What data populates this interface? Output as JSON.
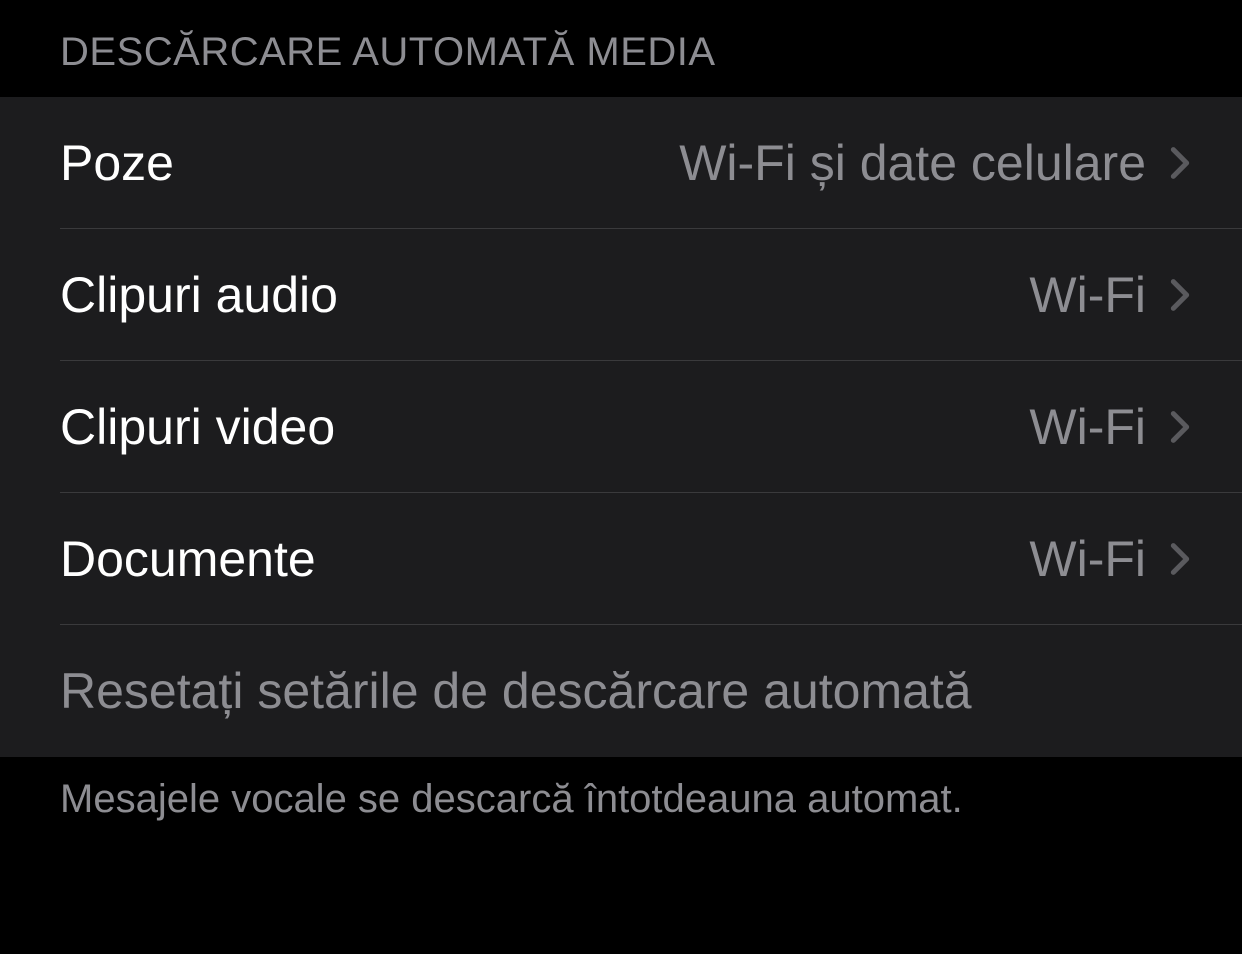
{
  "section": {
    "header": "DESCĂRCARE AUTOMATĂ MEDIA",
    "footer": "Mesajele vocale se descarcă întotdeauna automat."
  },
  "rows": [
    {
      "label": "Poze",
      "value": "Wi-Fi și date celulare"
    },
    {
      "label": "Clipuri audio",
      "value": "Wi-Fi"
    },
    {
      "label": "Clipuri video",
      "value": "Wi-Fi"
    },
    {
      "label": "Documente",
      "value": "Wi-Fi"
    }
  ],
  "reset": {
    "label": "Resetați setările de descărcare automată"
  }
}
